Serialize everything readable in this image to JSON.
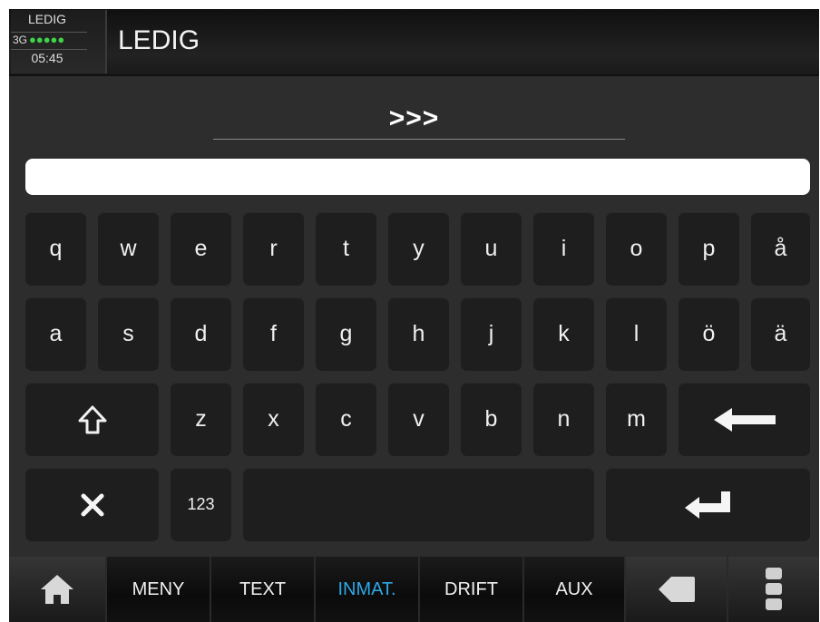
{
  "status": {
    "label": "LEDIG",
    "network": "3G",
    "signal_dots": "●●●●●",
    "time": "05:45",
    "signal_color": "#3fd24a"
  },
  "title": "LEDIG",
  "prompt": ">>>",
  "input": {
    "value": "",
    "placeholder": ""
  },
  "keyboard": {
    "row1": [
      "q",
      "w",
      "e",
      "r",
      "t",
      "y",
      "u",
      "i",
      "o",
      "p",
      "å"
    ],
    "row2": [
      "a",
      "s",
      "d",
      "f",
      "g",
      "h",
      "j",
      "k",
      "l",
      "ö",
      "ä"
    ],
    "row3": [
      "z",
      "x",
      "c",
      "v",
      "b",
      "n",
      "m"
    ],
    "numbers_label": "123",
    "icons": {
      "shift": "shift-arrow-icon",
      "backspace": "backspace-arrow-icon",
      "clear": "close-x-icon",
      "enter": "enter-return-icon"
    }
  },
  "nav": {
    "home_icon": "home-icon",
    "items": [
      "MENY",
      "TEXT",
      "INMAT.",
      "DRIFT",
      "AUX"
    ],
    "active": "INMAT.",
    "active_color": "#2ea7e6",
    "back_icon": "back-arrow-icon",
    "more_icon": "more-vertical-icon"
  }
}
